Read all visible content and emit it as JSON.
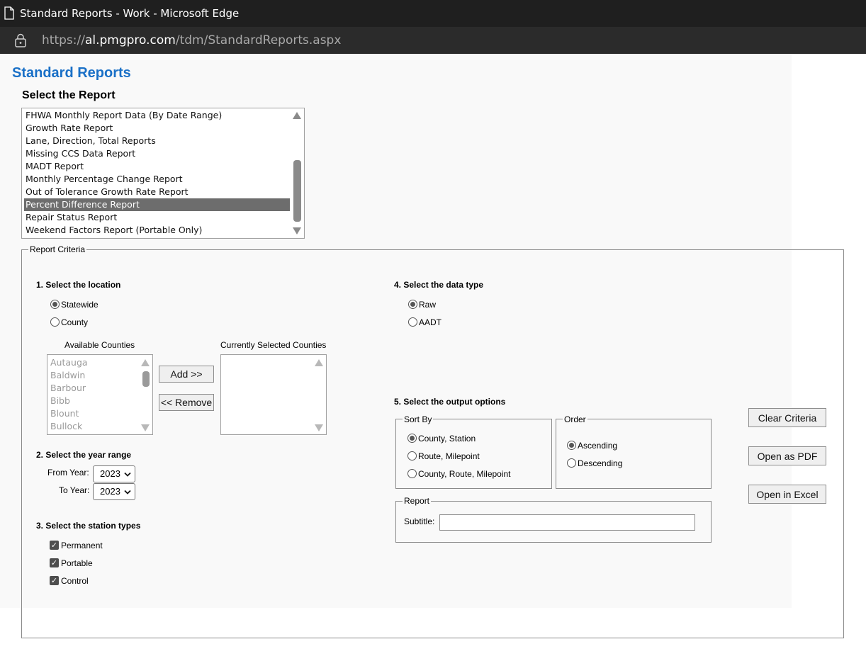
{
  "browser": {
    "window_title": "Standard Reports - Work - Microsoft Edge",
    "url_prefix": "https://",
    "url_host": "al.pmgpro.com",
    "url_path": "/tdm/StandardReports.aspx",
    "icons": [
      "document-icon",
      "lock-icon"
    ]
  },
  "page": {
    "title": "Standard Reports",
    "select_report_heading": "Select the Report"
  },
  "reports": {
    "items": [
      "FHWA Monthly Report Data (By Date Range)",
      "Growth Rate Report",
      "Lane, Direction, Total Reports",
      "Missing CCS Data Report",
      "MADT Report",
      "Monthly Percentage Change Report",
      "Out of Tolerance Growth Rate Report",
      "Percent Difference Report",
      "Repair Status Report",
      "Weekend Factors Report (Portable Only)"
    ],
    "selected": "Percent Difference Report",
    "selected_color": "#6d6d6d"
  },
  "criteria": {
    "legend": "Report Criteria",
    "location": {
      "heading": "1. Select the location",
      "statewide": "Statewide",
      "county": "County",
      "selected": "Statewide",
      "available_label": "Available Counties",
      "selected_label": "Currently Selected Counties",
      "available_counties": [
        "Autauga",
        "Baldwin",
        "Barbour",
        "Bibb",
        "Blount",
        "Bullock"
      ],
      "add_button": "Add >>",
      "remove_button": "<< Remove"
    },
    "year_range": {
      "heading": "2. Select the year range",
      "from_label": "From Year:",
      "from_value": "2023",
      "to_label": "To Year:",
      "to_value": "2023"
    },
    "station_types": {
      "heading": "3. Select the station types",
      "permanent": "Permanent",
      "portable": "Portable",
      "control": "Control",
      "checkmark": "✓"
    },
    "data_type": {
      "heading": "4. Select the data type",
      "raw": "Raw",
      "aadt": "AADT",
      "selected": "Raw"
    },
    "output": {
      "heading": "5. Select the output options",
      "sort_legend": "Sort By",
      "sort_county_station": "County, Station",
      "sort_route_milepoint": "Route, Milepoint",
      "sort_county_route_milepoint": "County, Route, Milepoint",
      "sort_selected": "County, Station",
      "order_legend": "Order",
      "ascending": "Ascending",
      "descending": "Descending",
      "order_selected": "Ascending",
      "report_legend": "Report",
      "subtitle_label": "Subtitle:",
      "subtitle_value": ""
    },
    "actions": {
      "clear": "Clear Criteria",
      "pdf": "Open as PDF",
      "excel": "Open in Excel"
    }
  },
  "colors": {
    "title_blue": "#1a70c7",
    "titlebar": "#1f1f1f",
    "addressbar": "#2b2b2b",
    "page_bg": "#f9f9f9"
  }
}
